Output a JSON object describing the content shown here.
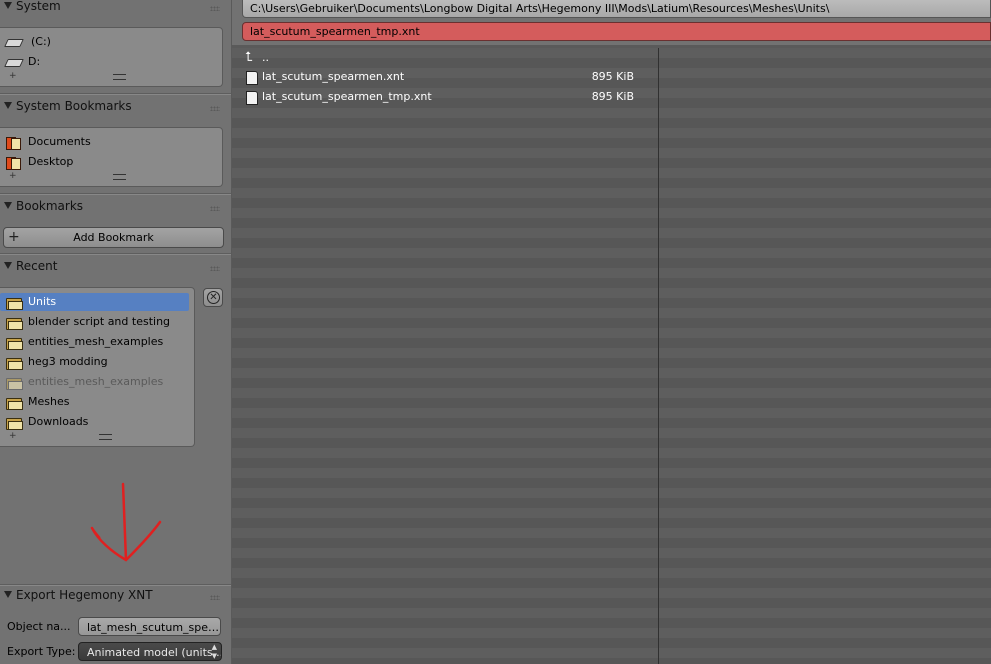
{
  "sidebar": {
    "system": {
      "title": "System",
      "items": [
        {
          "label": "(C:)",
          "icon": "drive-icon"
        },
        {
          "label": "D:",
          "icon": "drive-icon"
        }
      ]
    },
    "system_bookmarks": {
      "title": "System Bookmarks",
      "items": [
        {
          "label": "Documents",
          "icon": "bookmark-folder-icon"
        },
        {
          "label": "Desktop",
          "icon": "bookmark-folder-icon"
        }
      ]
    },
    "bookmarks": {
      "title": "Bookmarks",
      "add_label": "Add Bookmark"
    },
    "recent": {
      "title": "Recent",
      "items": [
        {
          "label": "Units",
          "selected": true
        },
        {
          "label": "blender script and testing"
        },
        {
          "label": "entities_mesh_examples"
        },
        {
          "label": "heg3 modding"
        },
        {
          "label": "entities_mesh_examples",
          "dimmed": true
        },
        {
          "label": "Meshes"
        },
        {
          "label": "Downloads"
        }
      ]
    },
    "export": {
      "title": "Export Hegemony XNT",
      "object_name_label": "Object na...",
      "object_name_value": "lat_mesh_scutum_spear...",
      "export_type_label": "Export Type:",
      "export_type_value": "Animated model (units ..."
    }
  },
  "header": {
    "path": "C:\\Users\\Gebruiker\\Documents\\Longbow Digital Arts\\Hegemony III\\Mods\\Latium\\Resources\\Meshes\\Units\\",
    "filename": "lat_scutum_spearmen_tmp.xnt"
  },
  "files": [
    {
      "name": "..",
      "size": "",
      "type": "parent"
    },
    {
      "name": "lat_scutum_spearmen.xnt",
      "size": "895 KiB",
      "type": "file"
    },
    {
      "name": "lat_scutum_spearmen_tmp.xnt",
      "size": "895 KiB",
      "type": "file"
    }
  ],
  "colors": {
    "selection": "#5680c2",
    "filename_field_error": "#d45c5c",
    "annotation_arrow": "#e02020"
  }
}
